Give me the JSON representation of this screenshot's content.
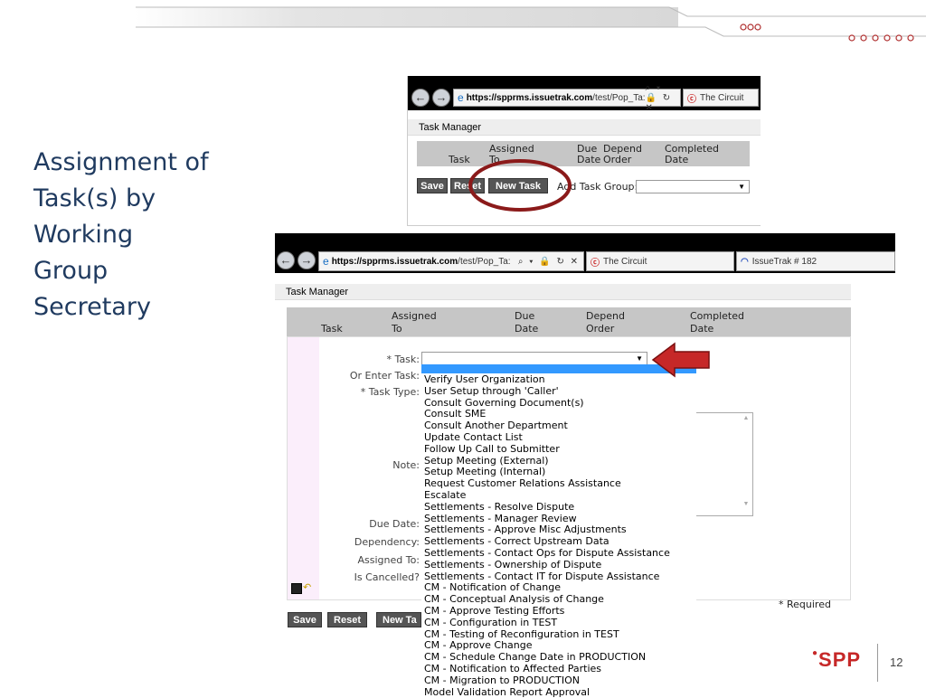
{
  "slide": {
    "title": "Assignment of\nTask(s) by\nWorking\nGroup\nSecretary",
    "page_number": "12",
    "logo_text": "SPP",
    "brand_color": "#c62828"
  },
  "browser_small": {
    "url_bold": "https://spprms.issuetrak.com",
    "url_rest": "/test/Pop_Ta:",
    "tab1": "The Circuit",
    "icons": "⌕ ▾ 🔒 ↻ ✕"
  },
  "browser_large": {
    "url_bold": "https://spprms.issuetrak.com",
    "url_rest": "/test/Pop_Ta:",
    "tab1": "The Circuit",
    "tab2": "IssueTrak # 182",
    "icons": "⌕ ▾ 🔒 ↻ ✕"
  },
  "task_manager": {
    "title": "Task Manager",
    "columns": {
      "task": "Task",
      "assigned_1": "Assigned",
      "assigned_2": "To",
      "due_1": "Due",
      "due_2": "Date",
      "depend_1": "Depend",
      "depend_2": "Order",
      "completed_1": "Completed",
      "completed_2": "Date"
    },
    "buttons": {
      "save": "Save",
      "reset": "Reset",
      "new_task": "New Task",
      "new_task_cut": "New Ta"
    },
    "add_task_group_label": "Add Task Group:",
    "required_note": "* Required"
  },
  "form": {
    "labels": {
      "task": "* Task:",
      "or_enter_task": "Or Enter Task:",
      "task_type": "* Task Type:",
      "note": "Note:",
      "due_date": "Due Date:",
      "dependency": "Dependency:",
      "assigned_to": "Assigned To:",
      "is_cancelled": "Is Cancelled?"
    },
    "task_selected": "",
    "task_options": [
      "Verify User Organization",
      "User Setup through 'Caller'",
      "Consult Governing Document(s)",
      "Consult SME",
      "Consult Another Department",
      "Update Contact List",
      "Follow Up Call to Submitter",
      "Setup Meeting (External)",
      "Setup Meeting (Internal)",
      "Request Customer Relations Assistance",
      "Escalate",
      "Settlements - Resolve Dispute",
      "Settlements - Manager Review",
      "Settlements - Approve Misc Adjustments",
      "Settlements - Correct Upstream Data",
      "Settlements - Contact Ops for Dispute Assistance",
      "Settlements - Ownership of Dispute",
      "Settlements - Contact IT for Dispute Assistance",
      "CM - Notification of Change",
      "CM - Conceptual Analysis of Change",
      "CM - Approve Testing Efforts",
      "CM - Configuration in TEST",
      "CM - Testing of Reconfiguration in TEST",
      "CM - Approve Change",
      "CM - Schedule Change Date in PRODUCTION",
      "CM - Notification to Affected Parties",
      "CM - Migration to PRODUCTION",
      "Model Validation Report Approval"
    ]
  }
}
